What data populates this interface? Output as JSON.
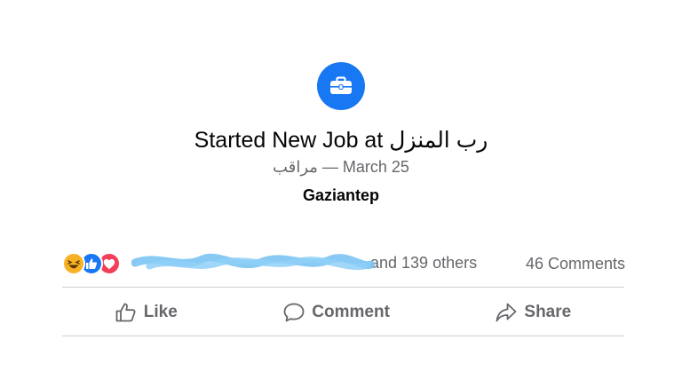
{
  "life_event": {
    "icon": "briefcase-icon",
    "title": "Started New Job at رب المنزل",
    "meta": "مراقب — March 25",
    "location": "Gaziantep"
  },
  "reactions": {
    "types": [
      "haha",
      "like",
      "love"
    ],
    "others_text": "and 139 others",
    "comments_count": "46 Comments"
  },
  "actions": {
    "like_label": "Like",
    "comment_label": "Comment",
    "share_label": "Share"
  },
  "colors": {
    "accent": "#1877f2",
    "secondary_text": "#65676b",
    "redaction": "#7cc4f4"
  }
}
